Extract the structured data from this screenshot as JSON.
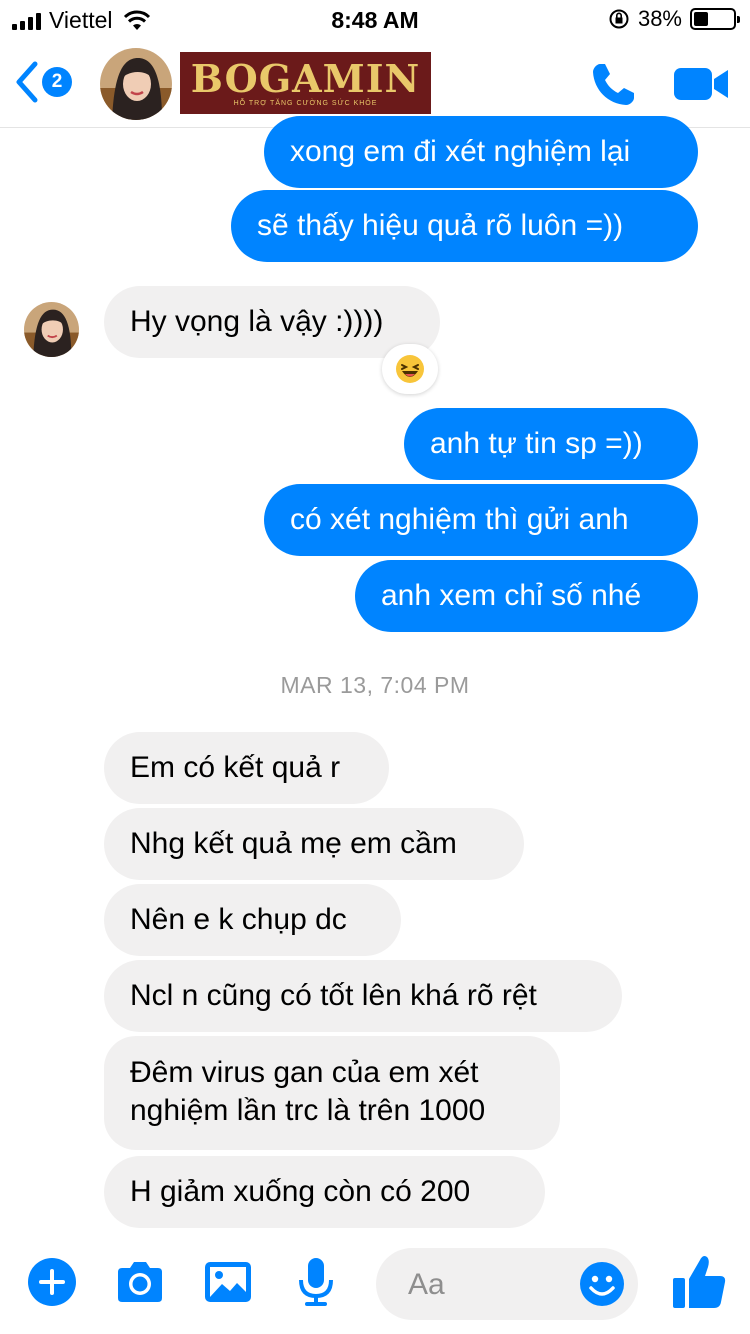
{
  "status_bar": {
    "carrier": "Viettel",
    "time": "8:48 AM",
    "battery": "38%",
    "battery_level": 0.38
  },
  "header": {
    "back_badge": "2",
    "logo": {
      "text": "BOGAMIN",
      "subtext": "HỖ TRỢ TĂNG CƯỜNG SỨC KHỎE"
    },
    "icons": [
      "back-chevron-icon",
      "phone-icon",
      "video-camera-icon"
    ]
  },
  "messages": [
    {
      "side": "out",
      "text": "xong em đi xét nghiệm lại"
    },
    {
      "side": "out",
      "text": "sẽ thấy hiệu quả rõ luôn =))"
    },
    {
      "side": "in",
      "text": "Hy vọng là vậy :))))",
      "reaction": "laughing-emoji"
    },
    {
      "side": "out",
      "text": "anh tự tin sp =))"
    },
    {
      "side": "out",
      "text": "có xét nghiệm thì gửi anh"
    },
    {
      "side": "out",
      "text": "anh xem chỉ số nhé"
    },
    {
      "side": "in",
      "text": "Em có kết quả r"
    },
    {
      "side": "in",
      "text": "Nhg kết quả mẹ em cầm"
    },
    {
      "side": "in",
      "text": "Nên e k chụp dc"
    },
    {
      "side": "in",
      "text": "Ncl n cũng có tốt lên khá rõ rệt"
    },
    {
      "side": "in",
      "text": "Đêm virus gan của em xét nghiệm lần trc là trên 1000"
    },
    {
      "side": "in",
      "text": "H giảm xuống còn có 200"
    }
  ],
  "timestamp": "MAR 13, 7:04 PM",
  "composer": {
    "placeholder": "Aa",
    "icons": [
      "plus-icon",
      "camera-icon",
      "photo-icon",
      "microphone-icon",
      "emoji-icon",
      "thumbs-up-icon"
    ]
  },
  "colors": {
    "accent": "#0084ff",
    "incoming_bubble": "#f1f0f0",
    "timestamp": "#9a9a9a"
  }
}
